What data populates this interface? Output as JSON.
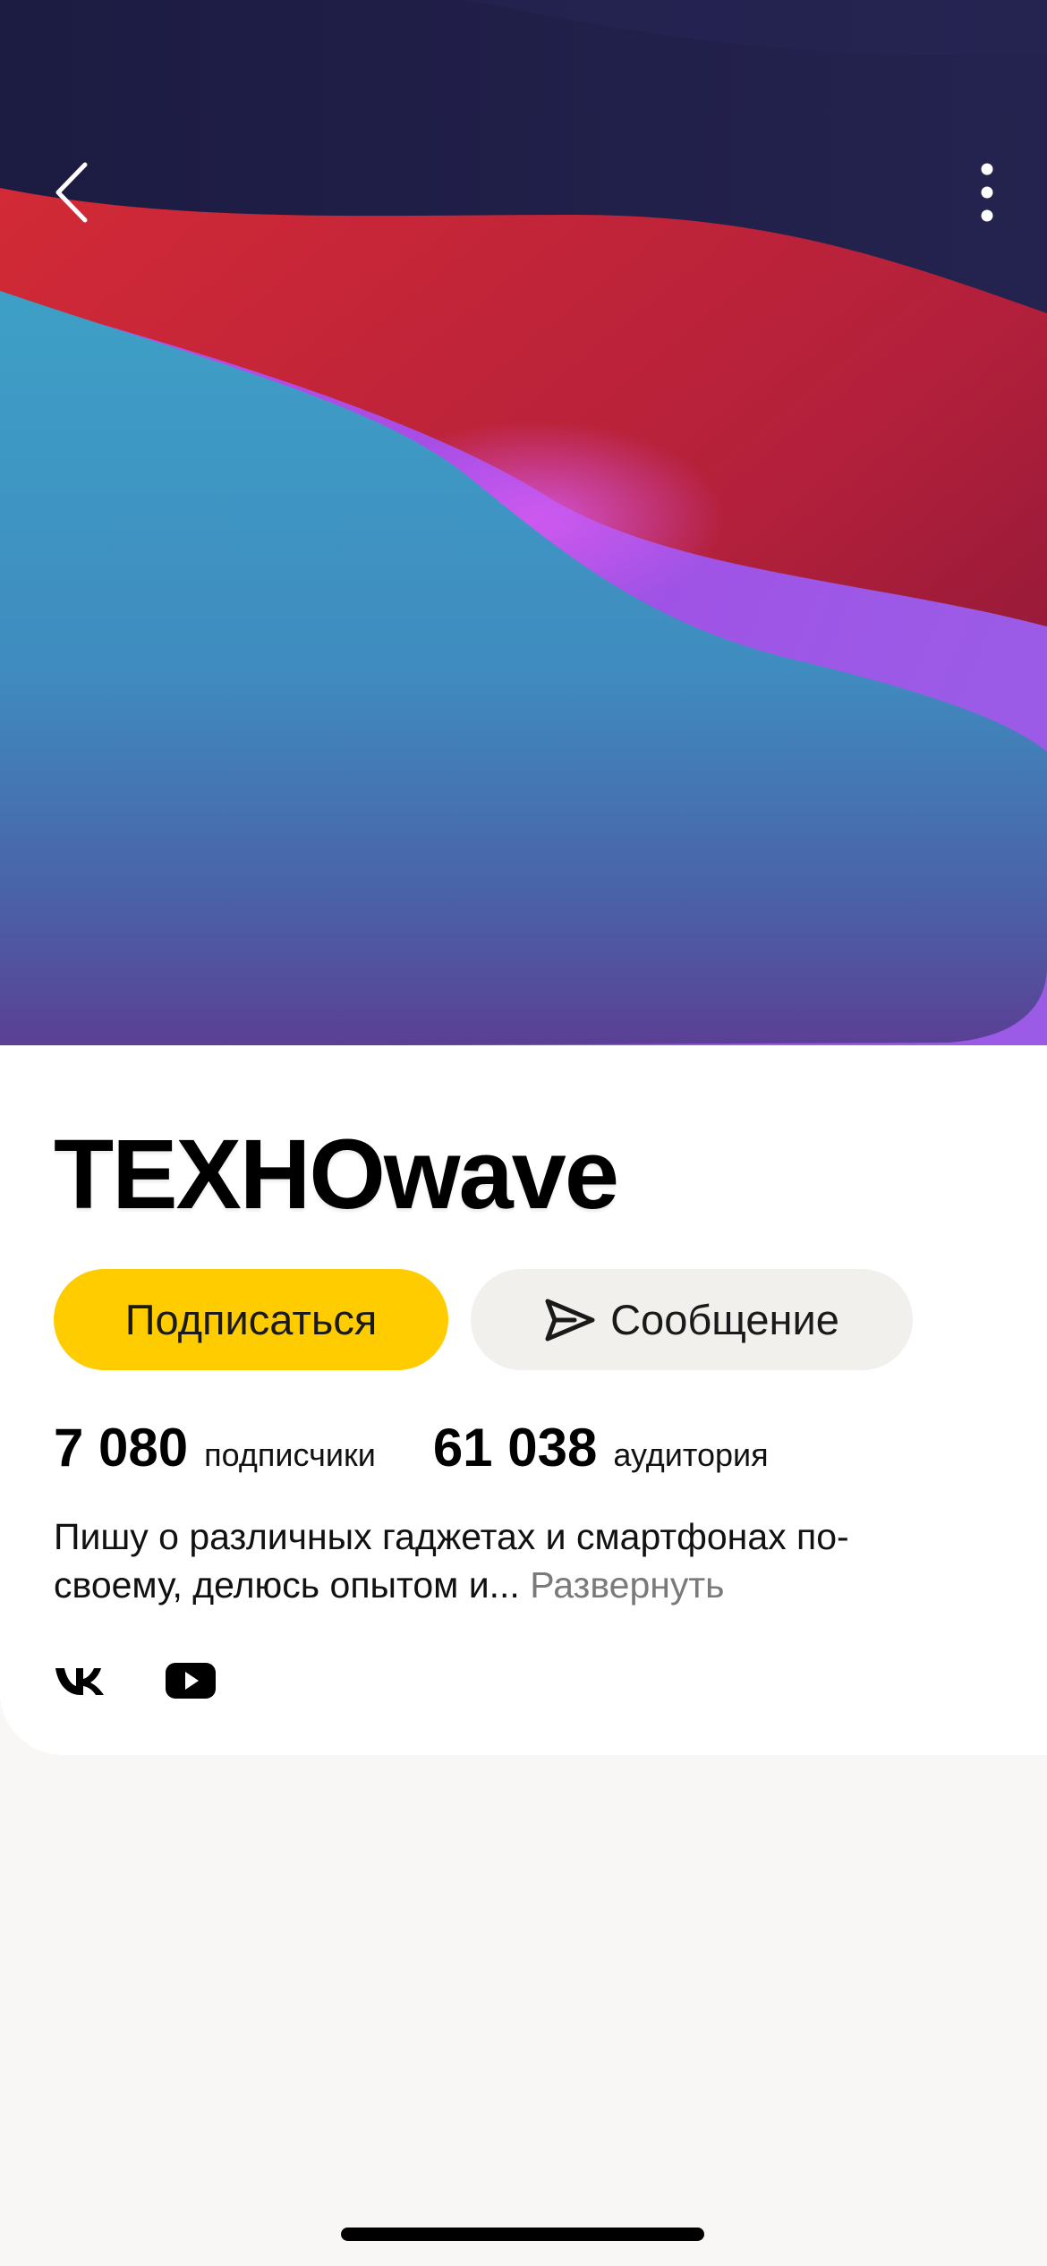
{
  "channel": {
    "name": "TEXHOwave",
    "description_text": "Пишу о различных гаджетах и смартфонах по-своему, делюсь опытом и...",
    "expand_label": "Развернуть"
  },
  "actions": {
    "subscribe_label": "Подписаться",
    "message_label": "Сообщение"
  },
  "stats": {
    "subscribers_value": "7 080",
    "subscribers_label": "подписчики",
    "audience_value": "61 038",
    "audience_label": "аудитория"
  },
  "icons": {
    "back": "back-chevron-icon",
    "more": "more-vertical-icon",
    "message": "paper-plane-icon",
    "vk": "vk-icon",
    "youtube": "youtube-icon"
  },
  "colors": {
    "accent_yellow": "#ffcc00",
    "secondary_button": "#f1f0ed",
    "cover_dark": "#1e1d45",
    "cover_red": "#c8283a",
    "cover_teal": "#3b9cc3",
    "cover_purple": "#b44ee0"
  }
}
